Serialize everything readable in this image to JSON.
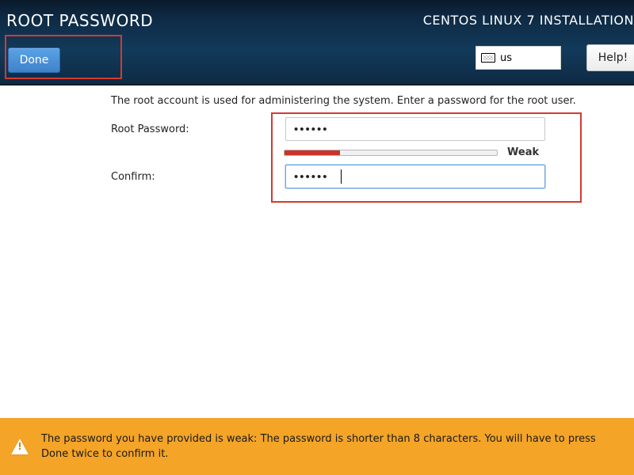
{
  "header": {
    "title": "ROOT PASSWORD",
    "subtitle": "CENTOS LINUX 7 INSTALLATION",
    "done_label": "Done",
    "keyboard_layout": "us",
    "help_label": "Help!"
  },
  "main": {
    "intro": "The root account is used for administering the system.  Enter a password for the root user.",
    "root_password_label": "Root Password:",
    "confirm_label": "Confirm:",
    "root_password_value": "••••••",
    "confirm_value": "••••••",
    "strength": {
      "label": "Weak",
      "percent": 26,
      "color": "#c9342a"
    }
  },
  "warning": {
    "text": "The password you have provided is weak: The password is shorter than 8 characters. You will have to press Done twice to confirm it."
  }
}
